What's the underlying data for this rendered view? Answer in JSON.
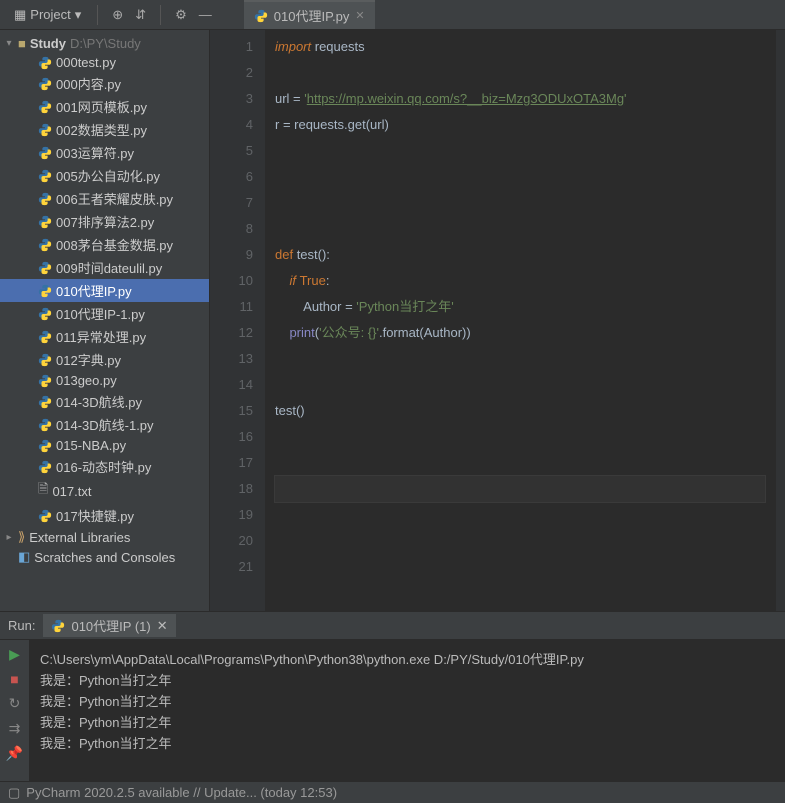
{
  "topbar": {
    "project_label": "Project",
    "icons": [
      "target-icon",
      "expand-icon",
      "gear-icon",
      "hide-icon"
    ]
  },
  "active_tab": {
    "label": "010代理IP.py"
  },
  "project_tree": {
    "root": {
      "name": "Study",
      "path": "D:\\PY\\Study"
    },
    "files": [
      {
        "name": "000test.py",
        "type": "py"
      },
      {
        "name": "000内容.py",
        "type": "py"
      },
      {
        "name": "001网页模板.py",
        "type": "py"
      },
      {
        "name": "002数据类型.py",
        "type": "py"
      },
      {
        "name": "003运算符.py",
        "type": "py"
      },
      {
        "name": "005办公自动化.py",
        "type": "py"
      },
      {
        "name": "006王者荣耀皮肤.py",
        "type": "py"
      },
      {
        "name": "007排序算法2.py",
        "type": "py"
      },
      {
        "name": "008茅台基金数据.py",
        "type": "py"
      },
      {
        "name": "009时间dateulil.py",
        "type": "py"
      },
      {
        "name": "010代理IP.py",
        "type": "py",
        "selected": true
      },
      {
        "name": "010代理IP-1.py",
        "type": "py"
      },
      {
        "name": "011异常处理.py",
        "type": "py"
      },
      {
        "name": "012字典.py",
        "type": "py"
      },
      {
        "name": "013geo.py",
        "type": "py"
      },
      {
        "name": "014-3D航线.py",
        "type": "py"
      },
      {
        "name": "014-3D航线-1.py",
        "type": "py"
      },
      {
        "name": "015-NBA.py",
        "type": "py"
      },
      {
        "name": "016-动态时钟.py",
        "type": "py"
      },
      {
        "name": "017.txt",
        "type": "txt"
      },
      {
        "name": "017快捷键.py",
        "type": "py"
      }
    ],
    "ext_libs": "External Libraries",
    "scratches": "Scratches and Consoles"
  },
  "code": {
    "lines": [
      {
        "n": 1,
        "html": "<span class='k-orange'>import</span> requests"
      },
      {
        "n": 2,
        "html": ""
      },
      {
        "n": 3,
        "html": "url = <span class='k-str'>'</span><span class='k-url'>https://mp.weixin.qq.com/s?__biz=Mzg3ODUxOTA3Mg</span><span class='k-str'>'</span>"
      },
      {
        "n": 4,
        "html": "r = requests.get(url)"
      },
      {
        "n": 5,
        "html": ""
      },
      {
        "n": 6,
        "html": ""
      },
      {
        "n": 7,
        "html": ""
      },
      {
        "n": 8,
        "html": ""
      },
      {
        "n": 9,
        "html": "<span class='k-kw'>def </span>test():"
      },
      {
        "n": 10,
        "html": "    <span class='k-orange'>if </span><span class='k-kw'>True</span>:"
      },
      {
        "n": 11,
        "html": "        Author = <span class='k-str'>'Python当打之年'</span>"
      },
      {
        "n": 12,
        "html": "    <span class='k-builtin'>print</span>(<span class='k-str'>'公众号: {}'</span>.format(Author))"
      },
      {
        "n": 13,
        "html": ""
      },
      {
        "n": 14,
        "html": ""
      },
      {
        "n": 15,
        "html": "test()"
      },
      {
        "n": 16,
        "html": ""
      },
      {
        "n": 17,
        "html": ""
      },
      {
        "n": 18,
        "html": "",
        "current": true
      },
      {
        "n": 19,
        "html": ""
      },
      {
        "n": 20,
        "html": ""
      },
      {
        "n": 21,
        "html": ""
      }
    ]
  },
  "run": {
    "label": "Run:",
    "tab_label": "010代理IP (1)",
    "output": [
      "C:\\Users\\ym\\AppData\\Local\\Programs\\Python\\Python38\\python.exe D:/PY/Study/010代理IP.py",
      "我是：Python当打之年",
      "我是：Python当打之年",
      "我是：Python当打之年",
      "我是：Python当打之年"
    ]
  },
  "statusbar": {
    "text": "PyCharm 2020.2.5 available // Update... (today 12:53)"
  }
}
